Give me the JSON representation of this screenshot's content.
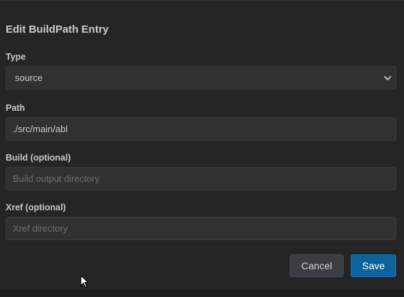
{
  "dialog": {
    "title": "Edit BuildPath Entry"
  },
  "form": {
    "type": {
      "label": "Type",
      "selected": "source"
    },
    "path": {
      "label": "Path",
      "value": "./src/main/abl"
    },
    "build": {
      "label": "Build (optional)",
      "value": "",
      "placeholder": "Build output directory"
    },
    "xref": {
      "label": "Xref (optional)",
      "value": "",
      "placeholder": "Xref directory"
    }
  },
  "buttons": {
    "cancel_label": "Cancel",
    "save_label": "Save"
  },
  "colors": {
    "background": "#252526",
    "field": "#313131",
    "primary_button": "#0e639c",
    "secondary_button": "#3a3d41"
  },
  "icons": {
    "select_arrow": "chevron-down-icon",
    "pointer": "mouse-cursor-icon"
  }
}
